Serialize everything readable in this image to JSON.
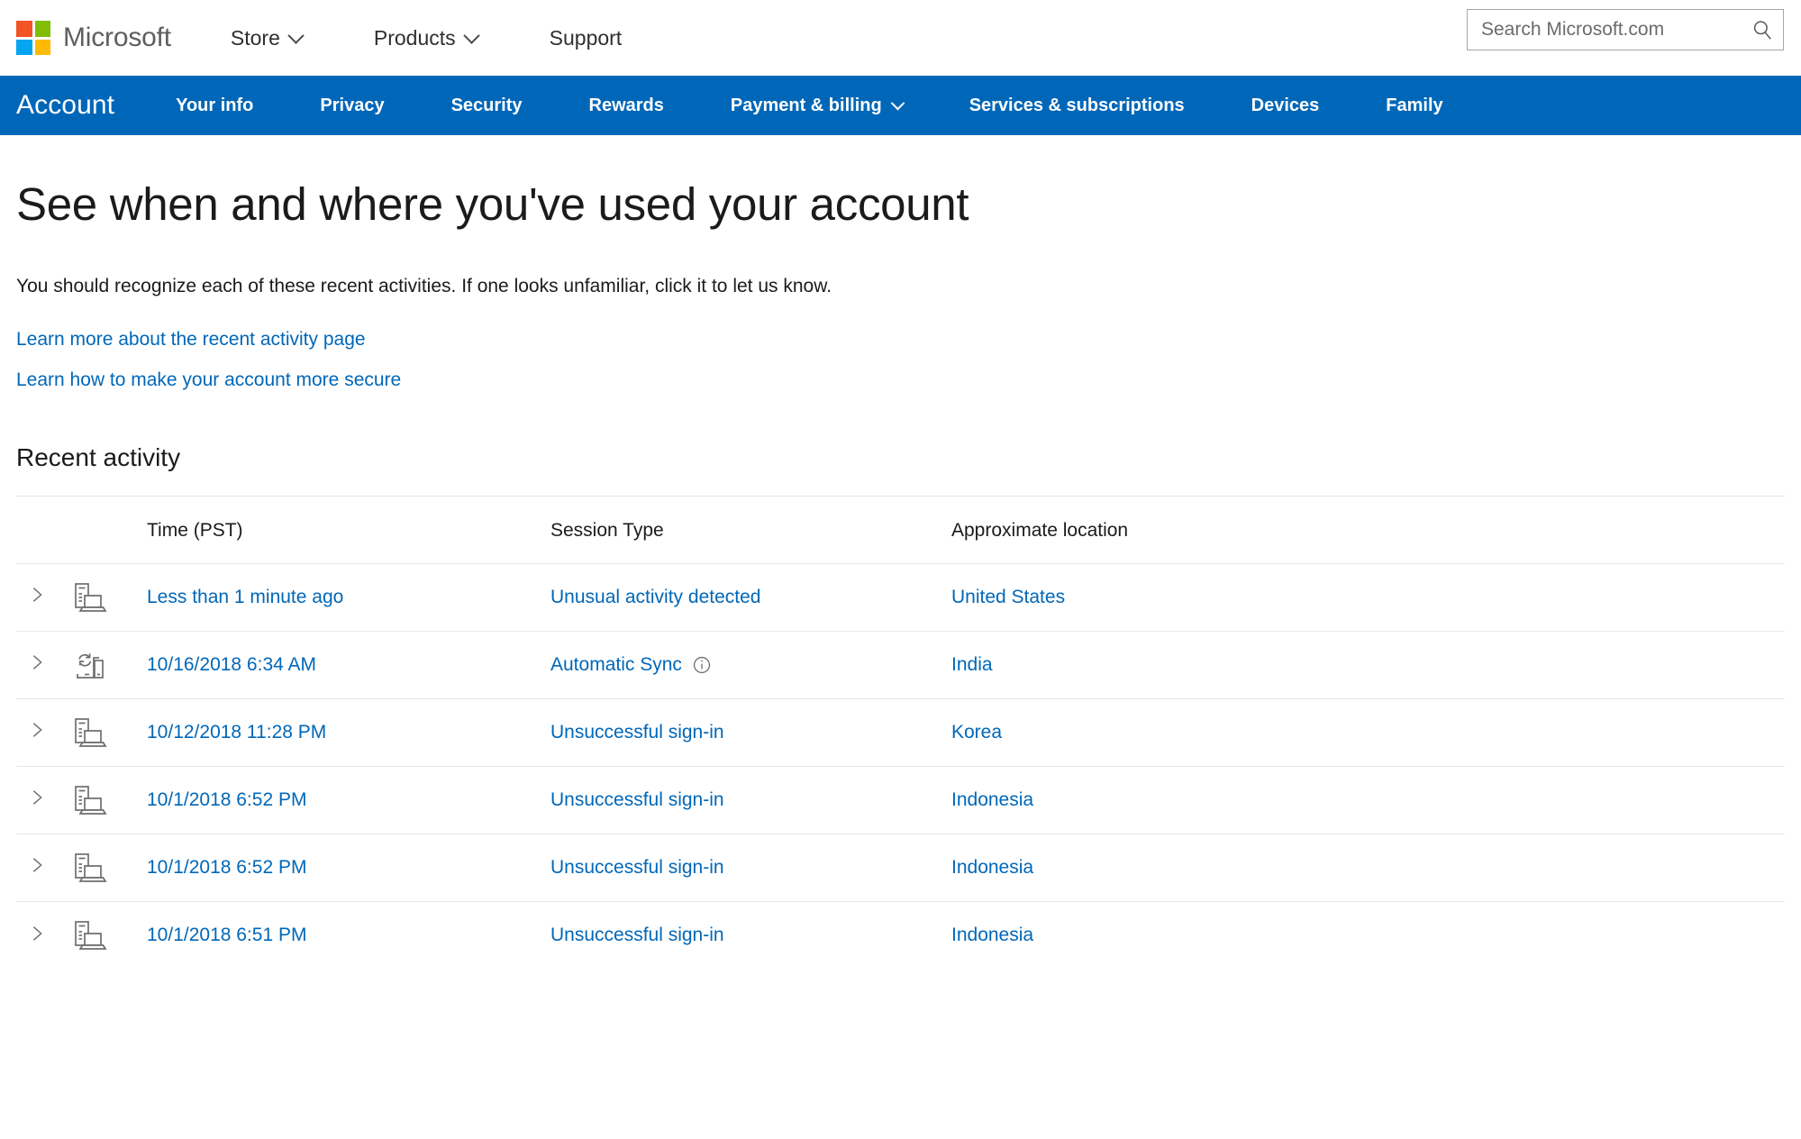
{
  "header": {
    "logo_name": "microsoft-logo",
    "wordmark": "Microsoft",
    "logo_colors": {
      "top_left": "#f35325",
      "top_right": "#81bc06",
      "bottom_left": "#05a6f0",
      "bottom_right": "#ffba08"
    },
    "nav": [
      {
        "label": "Store",
        "has_caret": true
      },
      {
        "label": "Products",
        "has_caret": true
      },
      {
        "label": "Support",
        "has_caret": false
      }
    ],
    "search": {
      "placeholder": "Search Microsoft.com",
      "value": "",
      "icon": "search-icon"
    }
  },
  "account_nav": {
    "brand": "Account",
    "accent_color": "#0067b8",
    "active_item": "Security",
    "items": [
      {
        "label": "Your info",
        "has_caret": false
      },
      {
        "label": "Privacy",
        "has_caret": false
      },
      {
        "label": "Security",
        "has_caret": false
      },
      {
        "label": "Rewards",
        "has_caret": false
      },
      {
        "label": "Payment & billing",
        "has_caret": true
      },
      {
        "label": "Services & subscriptions",
        "has_caret": false
      },
      {
        "label": "Devices",
        "has_caret": false
      },
      {
        "label": "Family",
        "has_caret": false
      }
    ]
  },
  "main": {
    "title": "See when and where you've used your account",
    "description": "You should recognize each of these recent activities. If one looks unfamiliar, click it to let us know.",
    "links": [
      "Learn more about the recent activity page",
      "Learn how to make your account more secure"
    ],
    "section_title": "Recent activity",
    "link_color": "#0067b8",
    "table": {
      "headers": [
        "",
        "",
        "Time (PST)",
        "Session Type",
        "Approximate location"
      ],
      "rows": [
        {
          "icon": "device-laptop-icon",
          "time": "Less than 1 minute ago",
          "session_type": "Unusual activity detected",
          "has_info_icon": false,
          "location": "United States"
        },
        {
          "icon": "sync-devices-icon",
          "time": "10/16/2018 6:34 AM",
          "session_type": "Automatic Sync",
          "has_info_icon": true,
          "location": "India"
        },
        {
          "icon": "device-laptop-icon",
          "time": "10/12/2018 11:28 PM",
          "session_type": "Unsuccessful sign-in",
          "has_info_icon": false,
          "location": "Korea"
        },
        {
          "icon": "device-laptop-icon",
          "time": "10/1/2018 6:52 PM",
          "session_type": "Unsuccessful sign-in",
          "has_info_icon": false,
          "location": "Indonesia"
        },
        {
          "icon": "device-laptop-icon",
          "time": "10/1/2018 6:52 PM",
          "session_type": "Unsuccessful sign-in",
          "has_info_icon": false,
          "location": "Indonesia"
        },
        {
          "icon": "device-laptop-icon",
          "time": "10/1/2018 6:51 PM",
          "session_type": "Unsuccessful sign-in",
          "has_info_icon": false,
          "location": "Indonesia"
        }
      ]
    }
  }
}
